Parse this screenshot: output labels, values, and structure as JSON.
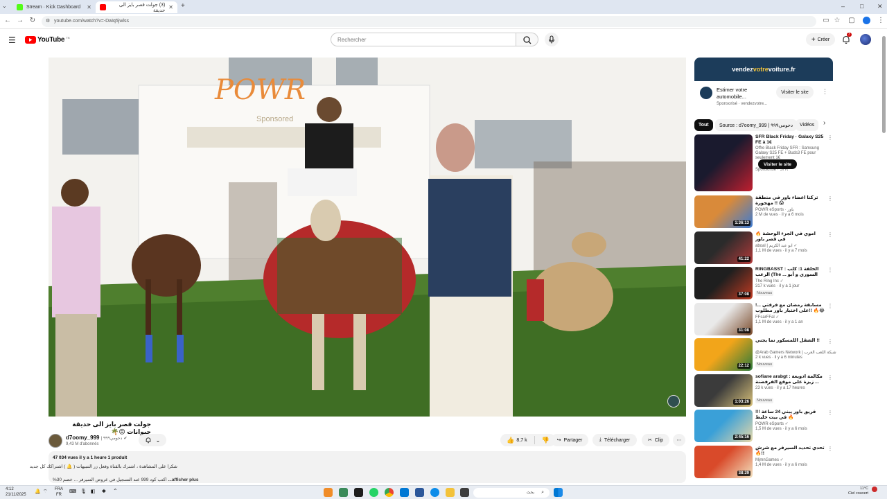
{
  "browser": {
    "tabs": [
      {
        "label": "Stream · Kick Dashboard",
        "favicon_color": "#53fc18",
        "active": false
      },
      {
        "label": "(3) جولت قصر بايز الى حديقة",
        "favicon_color": "#ff0000",
        "active": true
      }
    ],
    "new_tab_label": "+",
    "url": "youtube.com/watch?v=-DaIq5jwlss",
    "window_controls": {
      "minimize": "–",
      "maximize": "□",
      "close": "✕"
    }
  },
  "header": {
    "logo_text": "YouTube",
    "logo_superscript": "TN",
    "search_placeholder": "Rechercher",
    "create_label": "Créer",
    "notification_count": "3"
  },
  "video": {
    "title": "جولت قصر بايز الى حديقة حيوانات 😡🌴",
    "sign_text": "POWR",
    "sign_subtext": "Sponsored"
  },
  "channel": {
    "name": "d7oomy_999",
    "arabic_suffix": "| دحومي٩٩٩",
    "subscribers": "9,43 M d'abonnés"
  },
  "actions": {
    "like_count": "8,7 k",
    "share_label": "Partager",
    "download_label": "Télécharger",
    "clip_label": "Clip"
  },
  "description": {
    "stats": "47 034 vues  il y a 1 heure  1 produit",
    "line1": "شكرا على المشاهدة ، اشترك بالقناة وفعل زر التنبيهات ( 🔔 ) اشتراكك كل جديد",
    "line2": "%30 اكتب كود 999 عند التسجيل في عروض السيرفر ... خصم ",
    "more_label": "...afficher plus"
  },
  "ad": {
    "banner_pre": "vendez",
    "banner_accent": "votre",
    "banner_post": "voiture.fr",
    "title": "Estimer votre automobile...",
    "sponsor": "Sponsorisé · vendezvotre...",
    "visit_label": "Visiter le site"
  },
  "chips": [
    "Tout",
    "Source : d7oomy_999 | دحومي٩٩٩",
    "Vidéos"
  ],
  "recommendations": [
    {
      "title": "SFR Black Friday · Galaxy S25 FE à 1€",
      "channel": "Offre Black Friday SFR : Samsung Galaxy S25 FE + Buds3 FE pour seulement 1€",
      "meta": "Sponsorisé · SFR",
      "duration": "",
      "badge": "",
      "thumb_a": "#1a1a2e",
      "thumb_b": "#c01f2f",
      "is_ad": true,
      "ad_cta": "Visiter le site"
    },
    {
      "title": "تركنا اعضاء باور في منطقة مهجورة !! 😱",
      "channel": "POWR eSports · باور",
      "meta": "2 M de vues · il y a 6 mois",
      "duration": "1:36:13",
      "badge": "",
      "thumb_a": "#d98a3a",
      "thumb_b": "#3a7bd5"
    },
    {
      "title": "🔥 اموي في الجزء الوحشة في قصر باور",
      "channel": "aboal | ابو عبد الكريم ✓",
      "meta": "1,1 M de vues · il y a 7 mois",
      "duration": "41:22",
      "badge": "",
      "thumb_a": "#2b2b2b",
      "thumb_b": "#b33a3a"
    },
    {
      "title": "RINGBASST : الحلقة 1: كلب الرعب (The ... السوري و أبو عبد، رياضية نحشق",
      "channel": "The Ring Inc ✓",
      "meta": "317 k vues · il y a 1 jour",
      "duration": "37:08",
      "badge": "Nouveau",
      "thumb_a": "#1f1f1f",
      "thumb_b": "#c23b22"
    },
    {
      "title": "مسابقة رمضان مع فرقتي ...! على اختبار باور مطلوب!! 🔥😂",
      "channel": "FFsarFFal ✓",
      "meta": "1,1 M de vues · il y a 1 an",
      "duration": "31:08",
      "badge": "",
      "thumb_a": "#e9e9e9",
      "thumb_b": "#7a4a2a"
    },
    {
      "title": "الشقل اللمسكور نما يجني !!",
      "channel": "@Arab Gamers Network | شبكة اللعب العرب",
      "meta": "2 k vues · il y a 6 minutes",
      "duration": "22:12",
      "badge": "Nouveau",
      "thumb_a": "#f2a51a",
      "thumb_b": "#2a7a3b"
    },
    {
      "title": "sofiane arabgt : مكالمة ادويعة ... زيزة على موقع الفرفضنة الإنجلتي بلشك أسكن",
      "channel": "23 k vues · il y a 17 heures",
      "meta": "",
      "duration": "1:03:26",
      "badge": "Nouveau",
      "thumb_a": "#3b3b3b",
      "thumb_b": "#d9c27a"
    },
    {
      "title": "!!! فريق باور يبني 24 ساعة في بيت خليط 🔥",
      "channel": "POWR eSports ✓",
      "meta": "1,5 M de vues · il y a 6 mois",
      "duration": "2:45:16",
      "badge": "",
      "thumb_a": "#3aa0d8",
      "thumb_b": "#e7d8a8"
    },
    {
      "title": "تحدي تحديد السيرفر مع شرش 🔥!!",
      "channel": "MjmnGames ✓",
      "meta": "1,4 M de vues · il y a 6 mois",
      "duration": "38:29",
      "badge": "",
      "thumb_a": "#d94a2a",
      "thumb_b": "#f3e2c0"
    }
  ],
  "taskbar": {
    "time": "4:12",
    "date": "21/11/2025",
    "lang_top": "FRA",
    "lang_bottom": "FR",
    "search_label": "بحث",
    "weather_temp": "11°C",
    "weather_desc": "Ciel couvert"
  }
}
